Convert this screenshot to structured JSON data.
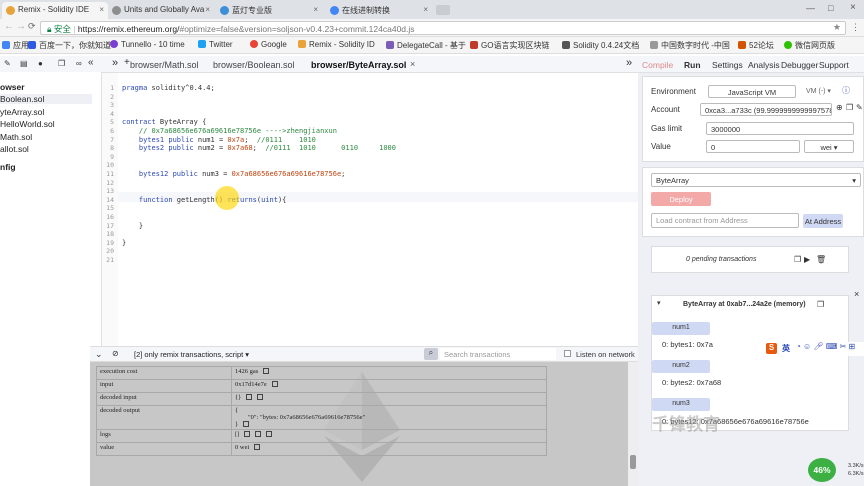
{
  "browser": {
    "tabs": [
      {
        "label": "Remix - Solidity IDE",
        "color": "#e8a33a",
        "active": true
      },
      {
        "label": "Units and Globally Ava",
        "color": "#8e8e8e",
        "active": false
      },
      {
        "label": "蓝灯专业版",
        "color": "#3b8fd8",
        "active": false
      },
      {
        "label": "在线进制转换",
        "color": "#4285f4",
        "active": false
      }
    ],
    "address": {
      "secure_label": "安全",
      "scheme_host": "https://remix.ethereum.org/",
      "path": "#optimize=false&version=soljson-v0.4.23+commit.124ca40d.js"
    },
    "bookmarks": [
      {
        "label": "应用",
        "color": "#4285f4"
      },
      {
        "label": "百度一下，你就知道",
        "color": "#2d5be3"
      },
      {
        "label": "Tunnello - 10 time",
        "color": "#7a3fd1"
      },
      {
        "label": "Twitter",
        "color": "#1da1f2"
      },
      {
        "label": "Google",
        "color": "#ea4335"
      },
      {
        "label": "Remix - Solidity ID",
        "color": "#e8a33a"
      },
      {
        "label": "DelegateCall - 基于",
        "color": "#7b5cb8"
      },
      {
        "label": "GO语言实现区块链",
        "color": "#c0392b"
      },
      {
        "label": "Solidity 0.4.24文档",
        "color": "#555555"
      },
      {
        "label": "中国数字时代 -中国",
        "color": "#999999"
      },
      {
        "label": "52论坛",
        "color": "#d35400"
      },
      {
        "label": "微信网页版",
        "color": "#2dc100"
      }
    ]
  },
  "file_explorer": {
    "root": "owser",
    "files": [
      "Boolean.sol",
      "yteArray.sol",
      "HelloWorld.sol",
      "Math.sol",
      "allot.sol"
    ],
    "config": "nfig"
  },
  "editor": {
    "tabs": [
      "browser/Math.sol",
      "browser/Boolean.sol",
      "browser/ByteArray.sol"
    ],
    "active_tab": 2,
    "lines": [
      {
        "n": "1",
        "html": "<span class=\"kw\">pragma</span> solidity^0.4.4;"
      },
      {
        "n": "2",
        "html": ""
      },
      {
        "n": "3",
        "html": ""
      },
      {
        "n": "4",
        "html": ""
      },
      {
        "n": "5",
        "html": "<span class=\"kw\">contract</span> ByteArray {"
      },
      {
        "n": "6",
        "html": "    <span class=\"cm\">// 0x7a68656e676a69616e78756e ---->zhengjianxun</span>"
      },
      {
        "n": "7",
        "html": "    <span class=\"kw\">bytes1 public</span> num1 = <span class=\"num\">0x7a</span>;  <span class=\"cm\">//0111    1010</span>"
      },
      {
        "n": "8",
        "html": "    <span class=\"kw\">bytes2 public</span> num2 = <span class=\"num\">0x7a68</span>;  <span class=\"cm\">//0111  1010      0110     1000</span>"
      },
      {
        "n": "9",
        "html": ""
      },
      {
        "n": "10",
        "html": ""
      },
      {
        "n": "11",
        "html": "    <span class=\"kw\">bytes12 public</span> num3 = <span class=\"num\">0x7a68656e676a69616e78756e</span>;"
      },
      {
        "n": "12",
        "html": ""
      },
      {
        "n": "13",
        "html": ""
      },
      {
        "n": "14",
        "html": "    <span class=\"kw\">function</span> getLength() <span class=\"kw\">returns</span>(<span class=\"kw\">uint</span>){"
      },
      {
        "n": "15",
        "html": ""
      },
      {
        "n": "16",
        "html": ""
      },
      {
        "n": "17",
        "html": "    }"
      },
      {
        "n": "18",
        "html": ""
      },
      {
        "n": "19",
        "html": "}"
      },
      {
        "n": "20",
        "html": ""
      },
      {
        "n": "21",
        "html": ""
      }
    ]
  },
  "terminal": {
    "filter_label": "[2] only remix transactions, script",
    "search_placeholder": "Search transactions",
    "listen_label": "Listen on network",
    "rows": [
      {
        "key": "execution cost",
        "value": "1426 gas"
      },
      {
        "key": "input",
        "value": "0x17d14e7e"
      },
      {
        "key": "decoded input",
        "value": "{}"
      },
      {
        "key": "decoded output",
        "value": "{\n        \"0\": \"bytes: 0x7a68656e676a69616e78756e\"\n}"
      },
      {
        "key": "logs",
        "value": "[]"
      },
      {
        "key": "value",
        "value": "0 wei"
      }
    ]
  },
  "run_panel": {
    "tabs": [
      "Compile",
      "Run",
      "Settings",
      "Analysis",
      "Debugger",
      "Support"
    ],
    "environment_label": "Environment",
    "environment_value": "JavaScript VM",
    "environment_suffix": "VM (-)",
    "account_label": "Account",
    "account_value": "0xca3...a733c (99.9999999999997578",
    "gas_limit_label": "Gas limit",
    "gas_limit_value": "3000000",
    "value_label": "Value",
    "value_value": "0",
    "value_unit": "wei",
    "contract_select": "ByteArray",
    "deploy_label": "Deploy",
    "at_address_placeholder": "Load contract from Address",
    "at_address_label": "At Address",
    "pending": "0 pending transactions",
    "instance_title": "ByteArray at 0xab7...24a2e (memory)",
    "functions": [
      {
        "name": "num1",
        "output": "0: bytes1: 0x7a"
      },
      {
        "name": "num2",
        "output": "0: bytes2: 0x7a68"
      },
      {
        "name": "num3",
        "output": "0: bytes12: 0x7a68656e676a69616e78756e"
      }
    ]
  },
  "overlay": {
    "record_percent": "46%",
    "watermark": "千锋教育",
    "ime": "英",
    "net_up": "3.3K/s",
    "net_down": "6.3K/s"
  }
}
